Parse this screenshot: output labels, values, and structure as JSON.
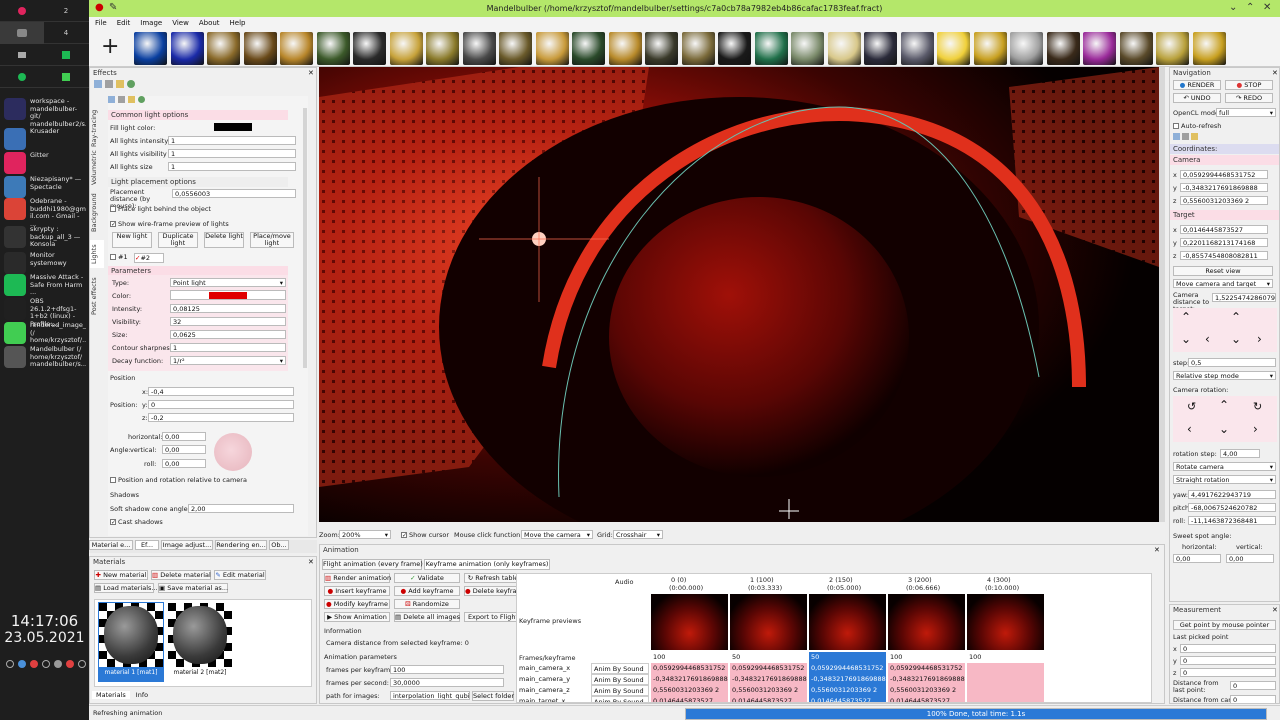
{
  "taskbar": {
    "workspaces": [
      "2",
      "4"
    ],
    "tasks": [
      {
        "label": "workspace - mandelbulber-git/ mandelbulber2/s...",
        "icon": "eclipse-icon",
        "color": "#2c2c5e"
      },
      {
        "label": "Krusader",
        "icon": "krusader-icon",
        "color": "#3a6fb5"
      },
      {
        "label": "Gitter",
        "icon": "gitter-icon",
        "color": "#e0245e"
      },
      {
        "label": "Niezapisany* — Spectacle",
        "icon": "spectacle-icon",
        "color": "#3d7ab8"
      },
      {
        "label": "Odebrane - buddhi1980@gma il.com - Gmail - ...",
        "icon": "chrome-icon",
        "color": "#db4437"
      },
      {
        "label": "skrypty : backup_all_3 — Konsola",
        "icon": "konsole-icon",
        "color": "#333333"
      },
      {
        "label": "Monitor systemowy",
        "icon": "monitor-icon",
        "color": "#2a2a2a"
      },
      {
        "label": "Massive Attack - Safe From Harm ...",
        "icon": "spotify-icon",
        "color": "#1db954"
      },
      {
        "label": "OBS 26.1.2+dfsg1-1+b2 (linux) - Profile:...",
        "icon": "obs-icon",
        "color": "#202020"
      },
      {
        "label": "rendered_image_widget.cpp (/ home/krzysztof/...",
        "icon": "qtcreator-icon",
        "color": "#41cd52"
      },
      {
        "label": "Mandelbulber (/ home/krzysztof/ mandelbulber/s...",
        "icon": "mandelbulber-icon",
        "color": "#555555"
      }
    ],
    "clock": {
      "time": "14:17:06",
      "date": "23.05.2021"
    }
  },
  "window": {
    "title": "Mandelbulber (/home/krzysztof/mandelbulber/settings/c7a0cb78a7982eb4b86cafac1783feaf.fract)",
    "title_color": "#b4e76a",
    "menu": [
      "File",
      "Edit",
      "Image",
      "View",
      "About",
      "Help"
    ]
  },
  "thumbnails": {
    "colors": [
      "#0a3fa0",
      "#1a2aa8",
      "#8a6a2a",
      "#6a4a1a",
      "#b8862a",
      "#3c5a2a",
      "#2a2a2a",
      "#c7a23a",
      "#8a7a2a",
      "#4a4a4a",
      "#6a5a2a",
      "#c89a3a",
      "#2a4a2a",
      "#b88a2a",
      "#3a3a2a",
      "#7a6a3a",
      "#1a1a1a",
      "#20704a",
      "#7a8a6a",
      "#d8c88a",
      "#2a2a3a",
      "#5a5a6a",
      "#f0d03a",
      "#c8a020",
      "#a0a0a0",
      "#3a2a1a",
      "#9a2a9a",
      "#5a4a2a",
      "#b8a03a",
      "#c8a020"
    ]
  },
  "effects": {
    "title": "Effects",
    "vertical_tabs": [
      "Ray-tracing",
      "Volumetric",
      "Background",
      "Lights",
      "Post effects"
    ],
    "common": {
      "header": "Common light options",
      "rows": [
        {
          "label": "Fill light color:",
          "value": ""
        },
        {
          "label": "All lights intensity",
          "value": "1"
        },
        {
          "label": "All lights visibility",
          "value": "1"
        },
        {
          "label": "All lights size",
          "value": "1"
        }
      ]
    },
    "placement": {
      "header": "Light placement options",
      "distance_label": "Placement distance (by mouse):",
      "distance_value": "0,0556003",
      "behind_label": "Place light behind the object",
      "wireframe_label": "Show wire-frame preview of lights"
    },
    "buttons": [
      "New light",
      "Duplicate light",
      "Delete light",
      "Place/move light"
    ],
    "light_tabs": [
      "#1",
      "#2"
    ],
    "parameters": {
      "header": "Parameters",
      "type_label": "Type:",
      "type_value": "Point light",
      "color_label": "Color:",
      "color_value": "#e00000",
      "intensity_label": "Intensity:",
      "intensity_value": "0,08125",
      "visibility_label": "Visibility:",
      "visibility_value": "32",
      "size_label": "Size:",
      "size_value": "0,0625",
      "contour_label": "Contour sharpness:",
      "contour_value": "1",
      "decay_label": "Decay function:",
      "decay_value": "1/r²"
    },
    "position": {
      "header": "Position",
      "x_label": "x:",
      "x_value": "-0,4",
      "pos_label": "Position:",
      "y_label": "y:",
      "y_value": "0",
      "z_label": "z:",
      "z_value": "-0,2",
      "horizontal_label": "horizontal:",
      "horizontal_value": "0,00",
      "angle_label": "Angle:",
      "vertical_label": "vertical:",
      "vertical_value": "0,00",
      "roll_label": "roll:",
      "roll_value": "0,00",
      "relative_label": "Position and rotation relative to camera"
    },
    "shadows": {
      "header": "Shadows",
      "cone_label": "Soft shadow cone angle:",
      "cone_value": "2,00",
      "cast_label": "Cast shadows"
    },
    "bottom_tabs": [
      "Material e...",
      "Ef...",
      "Image adjust...",
      "Rendering en...",
      "Ob..."
    ]
  },
  "materials": {
    "title": "Materials",
    "buttons": [
      "New material",
      "Delete material",
      "Edit material",
      "Load materials...",
      "Save material as..."
    ],
    "items": [
      {
        "label": "material 1 [mat1]"
      },
      {
        "label": "material 2 [mat2]"
      }
    ],
    "tabs": [
      "Materials",
      "Info"
    ]
  },
  "viewport_bar": {
    "zoom_label": "Zoom:",
    "zoom_value": "200%",
    "cursor_label": "Show cursor",
    "mouse_label": "Mouse click function:",
    "mouse_value": "Move the camera",
    "grid_label": "Grid:",
    "grid_value": "Crosshair"
  },
  "animation": {
    "title": "Animation",
    "tabs": [
      "Flight animation (every frame)",
      "Keyframe animation (only keyframes)"
    ],
    "buttons": [
      "Render animation",
      "Validate",
      "Refresh table",
      "Insert keyframe",
      "Add keyframe",
      "Delete keyframe",
      "Modify keyframe",
      "Randomize",
      "Show Animation",
      "Delete all images",
      "Export to Flight"
    ],
    "info_header": "Information",
    "info_text": "Camera distance from selected keyframe: 0",
    "params_header": "Animation parameters",
    "fpk_label": "frames per keyframe:",
    "fpk_value": "100",
    "fps_label": "frames per second:",
    "fps_value": "30,0000",
    "path_label": "path for images:",
    "path_value": "interpolation_light_qubic/",
    "select_folder": "Select folder",
    "table": {
      "audio": "Audio",
      "keyframe_previews": "Keyframe previews",
      "frames_label": "Frames/keyframe",
      "columns": [
        {
          "head": "0 (0)",
          "time": "(0:00.000)",
          "frames": "100"
        },
        {
          "head": "1 (100)",
          "time": "(0:03.333)",
          "frames": "50"
        },
        {
          "head": "2 (150)",
          "time": "(0:05.000)",
          "frames": "50"
        },
        {
          "head": "3 (200)",
          "time": "(0:06.666)",
          "frames": "100"
        },
        {
          "head": "4 (300)",
          "time": "(0:10.000)",
          "frames": "100"
        }
      ],
      "rows": [
        {
          "name": "main_camera_x",
          "audio": "Anim By Sound",
          "values": [
            "0,0592994468531752",
            "0,0592994468531752",
            "0,0592994468531752",
            "0,0592994468531752",
            ""
          ]
        },
        {
          "name": "main_camera_y",
          "audio": "Anim By Sound",
          "values": [
            "-0,3483217691869888",
            "-0,3483217691869888",
            "-0,3483217691869888",
            "-0,3483217691869888",
            ""
          ]
        },
        {
          "name": "main_camera_z",
          "audio": "Anim By Sound",
          "values": [
            "0,5560031203369 2",
            "0,5560031203369 2",
            "0,5560031203369 2",
            "0,5560031203369 2",
            ""
          ]
        },
        {
          "name": "main_target_x",
          "audio": "Anim By Sound",
          "values": [
            "0,0146445873527",
            "0,0146445873527",
            "0,0146445873527",
            "0,0146445873527",
            ""
          ]
        }
      ]
    }
  },
  "navigation": {
    "title": "Navigation",
    "render": "RENDER",
    "stop": "STOP",
    "undo": "UNDO",
    "redo": "REDO",
    "opencl_label": "OpenCL mode:",
    "opencl_value": "full",
    "autorefresh": "Auto-refresh",
    "coords_header": "Coordinates:",
    "camera_label": "Camera",
    "camera": [
      "0,0592994468531752",
      "-0,3483217691869888",
      "0,5560031203369 2"
    ],
    "target_label": "Target",
    "target": [
      "0,0146445873527",
      "0,2201168213174168",
      "-0,8557454808082811"
    ],
    "reset_view": "Reset view",
    "move_mode": "Move camera and target",
    "dist_label": "Camera distance to target:",
    "dist_value": "1,5225474286079",
    "step_label": "step:",
    "step_value": "0,5",
    "step_mode": "Relative step mode",
    "rotation_header": "Camera rotation:",
    "rot_step_label": "rotation step:",
    "rot_step_value": "4,00",
    "rotate_mode": "Rotate camera",
    "rotation_mode": "Straight rotation",
    "yaw_label": "yaw:",
    "yaw_value": "4,4917622943719",
    "pitch_label": "pitch:",
    "pitch_value": "-68,0067524620782",
    "roll_label": "roll:",
    "roll_value": "-11,1463872368481",
    "sweet_label": "Sweet spot angle:",
    "sweet_h_label": "horizontal:",
    "sweet_h_value": "0,00",
    "sweet_v_label": "vertical:",
    "sweet_v_value": "0,00",
    "measurement_title": "Measurement",
    "get_point": "Get point by mouse pointer",
    "last_point_label": "Last picked point",
    "last_point": [
      "0",
      "0",
      "0"
    ],
    "dist_last_label": "Distance from last point:",
    "dist_last_value": "0",
    "dist_cam_label": "Distance from camera",
    "dist_cam_value": "0"
  },
  "status": {
    "left": "Refreshing animation",
    "progress_text": "100% Done, total time: 1.1s",
    "progress": 1.0,
    "progress_color": "#2b79d6"
  }
}
